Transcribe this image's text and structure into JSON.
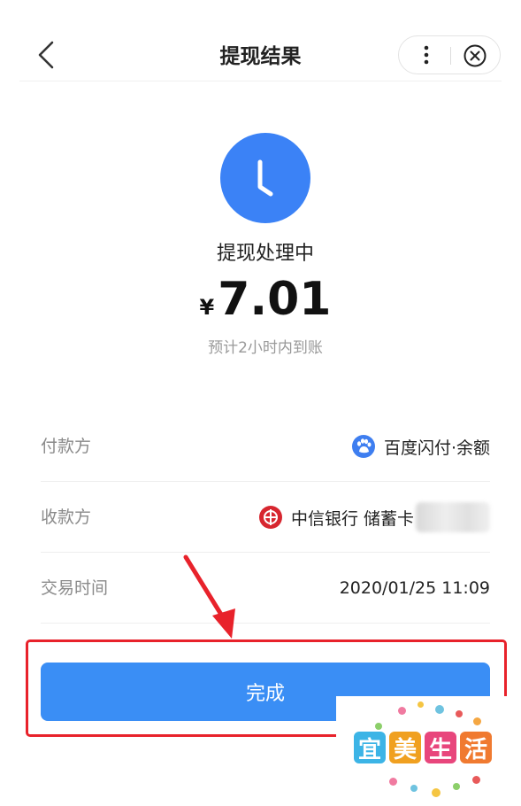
{
  "header": {
    "title": "提现结果",
    "back_icon": "chevron-left-icon",
    "more_icon": "vertical-dots-icon",
    "close_icon": "circle-close-icon"
  },
  "result": {
    "status": "提现处理中",
    "currency": "¥",
    "amount": "7.01",
    "eta": "预计2小时内到账",
    "status_icon": "clock-icon",
    "accent": "#3b82f6"
  },
  "details": [
    {
      "label": "付款方",
      "value": "百度闪付·余额",
      "icon": "baidu-paw-icon"
    },
    {
      "label": "收款方",
      "value": "中信银行 储蓄卡",
      "icon": "citic-bank-icon"
    },
    {
      "label": "交易时间",
      "value": "2020/01/25 11:09"
    }
  ],
  "done_button": {
    "label": "完成",
    "color": "#3a8ef5"
  },
  "annotation": {
    "color": "#e8222b"
  },
  "watermark": {
    "text": [
      "宜",
      "美",
      "生",
      "活"
    ]
  }
}
